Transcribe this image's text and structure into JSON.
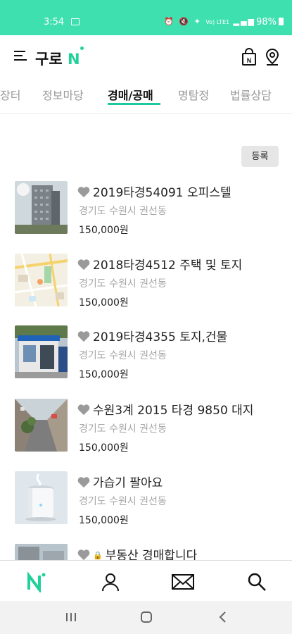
{
  "status_bar": {
    "time": "3:54",
    "battery": "98%",
    "icons": [
      "alarm-icon",
      "mute-icon",
      "wifi-icon",
      "lte-icon",
      "signal-icon",
      "battery-icon"
    ],
    "lte_label": "Vo) LTE1"
  },
  "header": {
    "logo_text": "구로",
    "logo_n": "N",
    "bag_label": "N"
  },
  "tabs": [
    {
      "label": "장터"
    },
    {
      "label": "정보마당"
    },
    {
      "label": "경매/공매",
      "active": true
    },
    {
      "label": "명탐정"
    },
    {
      "label": "법률상담"
    }
  ],
  "register_label": "등록",
  "listings": [
    {
      "title": "2019타경54091 오피스텔",
      "location": "경기도 수원시 권선동",
      "price": "150,000원",
      "thumb": "office-building-photo"
    },
    {
      "title": "2018타경4512 주택 및 토지",
      "location": "경기도 수원시 권선동",
      "price": "150,000원",
      "thumb": "map-photo"
    },
    {
      "title": "2019타경4355 토지,건물",
      "location": "경기도 수원시 권선동",
      "price": "150,000원",
      "thumb": "kiosk-building-photo"
    },
    {
      "title": "수원3계 2015 타경 9850 대지",
      "location": "경기도 수원시 권선동",
      "price": "150,000원",
      "thumb": "alley-photo"
    },
    {
      "title": "가습기 팔아요",
      "location": "경기도 수원시 권선동",
      "price": "150,000원",
      "thumb": "humidifier-photo"
    },
    {
      "title": "부동산 경매합니다",
      "location": "",
      "price": "",
      "thumb": "building-photo",
      "locked": true,
      "lock_label": "🔒"
    }
  ],
  "bottom_nav": [
    "home-n-icon",
    "profile-icon",
    "message-icon",
    "search-icon"
  ],
  "colors": {
    "accent": "#20d29a",
    "status_bar": "#3fe0b0",
    "tab_underline": "#20c8a0",
    "heart": "#9a9a9a"
  }
}
